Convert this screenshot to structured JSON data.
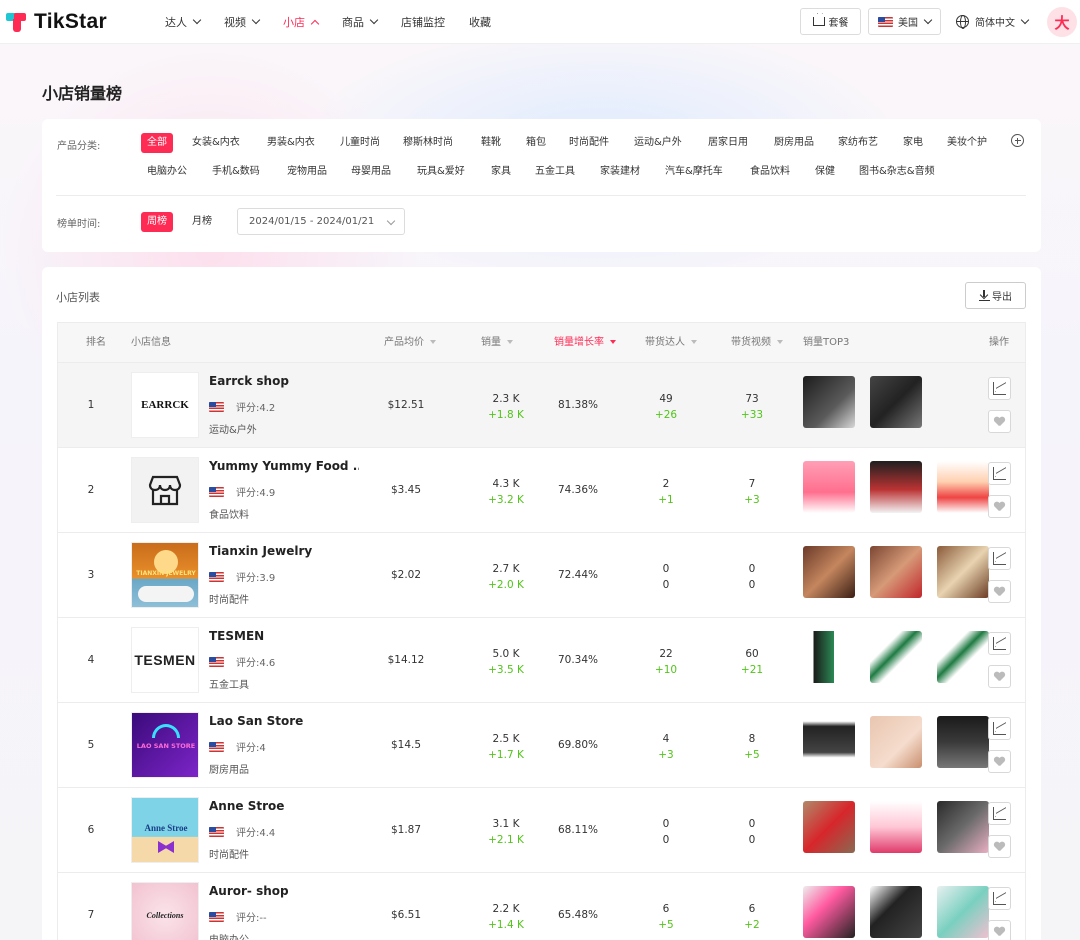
{
  "brand": {
    "name": "TikStar"
  },
  "nav": [
    {
      "label": "达人",
      "dropdown": true,
      "active": false
    },
    {
      "label": "视频",
      "dropdown": true,
      "active": false
    },
    {
      "label": "小店",
      "dropdown": true,
      "active": true
    },
    {
      "label": "商品",
      "dropdown": true,
      "active": false
    },
    {
      "label": "店铺监控",
      "dropdown": false,
      "active": false
    },
    {
      "label": "收藏",
      "dropdown": false,
      "active": false
    }
  ],
  "topbar": {
    "plan_label": "套餐",
    "region_label": "美国",
    "language_label": "简体中文",
    "avatar_text": "大"
  },
  "page": {
    "title": "小店销量榜"
  },
  "filters": {
    "category_label": "产品分类:",
    "categories": [
      "全部",
      "女装&内衣",
      "男装&内衣",
      "儿童时尚",
      "穆斯林时尚",
      "鞋靴",
      "箱包",
      "时尚配件",
      "运动&户外",
      "居家日用",
      "厨房用品",
      "家纺布艺",
      "家电",
      "美妆个护",
      "电脑办公",
      "手机&数码",
      "宠物用品",
      "母婴用品",
      "玩具&爱好",
      "家具",
      "五金工具",
      "家装建材",
      "汽车&摩托车",
      "食品饮料",
      "保健",
      "图书&杂志&音频"
    ],
    "selected_category": "全部",
    "period_label": "榜单时间:",
    "periods": [
      "周榜",
      "月榜"
    ],
    "selected_period": "周榜",
    "date_range": "2024/01/15 - 2024/01/21"
  },
  "list": {
    "title": "小店列表",
    "export_label": "导出",
    "columns": {
      "rank": "排名",
      "shop": "小店信息",
      "price": "产品均价",
      "sales": "销量",
      "growth": "销量增长率",
      "kol": "带货达人",
      "videos": "带货视频",
      "top3": "销量TOP3",
      "actions": "操作"
    },
    "sorted_column": "销量增长率",
    "rows": [
      {
        "rank": "1",
        "name": "Earrck shop",
        "logo_text": "EARRCK",
        "rating": "评分:4.2",
        "category": "运动&户外",
        "price": "$12.51",
        "sales": "2.3 K",
        "sales_delta": "+1.8 K",
        "growth": "81.38%",
        "kol": "49",
        "kol_delta": "+26",
        "videos": "73",
        "videos_delta": "+33",
        "top3_count": 2
      },
      {
        "rank": "2",
        "name": "Yummy Yummy Food ...",
        "logo_text": "",
        "rating": "评分:4.9",
        "category": "食品饮料",
        "price": "$3.45",
        "sales": "4.3 K",
        "sales_delta": "+3.2 K",
        "growth": "74.36%",
        "kol": "2",
        "kol_delta": "+1",
        "videos": "7",
        "videos_delta": "+3",
        "top3_count": 3
      },
      {
        "rank": "3",
        "name": "Tianxin Jewelry",
        "logo_text": "TIANXIN JEWELRY",
        "rating": "评分:3.9",
        "category": "时尚配件",
        "price": "$2.02",
        "sales": "2.7 K",
        "sales_delta": "+2.0 K",
        "growth": "72.44%",
        "kol": "0",
        "kol_delta": "0",
        "videos": "0",
        "videos_delta": "0",
        "top3_count": 3
      },
      {
        "rank": "4",
        "name": "TESMEN",
        "logo_text": "TESMEN",
        "rating": "评分:4.6",
        "category": "五金工具",
        "price": "$14.12",
        "sales": "5.0 K",
        "sales_delta": "+3.5 K",
        "growth": "70.34%",
        "kol": "22",
        "kol_delta": "+10",
        "videos": "60",
        "videos_delta": "+21",
        "top3_count": 3
      },
      {
        "rank": "5",
        "name": "Lao San Store",
        "logo_text": "LAO SAN STORE",
        "rating": "评分:4",
        "category": "厨房用品",
        "price": "$14.5",
        "sales": "2.5 K",
        "sales_delta": "+1.7 K",
        "growth": "69.80%",
        "kol": "4",
        "kol_delta": "+3",
        "videos": "8",
        "videos_delta": "+5",
        "top3_count": 3
      },
      {
        "rank": "6",
        "name": "Anne Stroe",
        "logo_text": "Anne Stroe",
        "rating": "评分:4.4",
        "category": "时尚配件",
        "price": "$1.87",
        "sales": "3.1 K",
        "sales_delta": "+2.1 K",
        "growth": "68.11%",
        "kol": "0",
        "kol_delta": "0",
        "videos": "0",
        "videos_delta": "0",
        "top3_count": 3
      },
      {
        "rank": "7",
        "name": "Auror- shop",
        "logo_text": "Collections",
        "rating": "评分:--",
        "category": "电脑办公",
        "price": "$6.51",
        "sales": "2.2 K",
        "sales_delta": "+1.4 K",
        "growth": "65.48%",
        "kol": "6",
        "kol_delta": "+5",
        "videos": "6",
        "videos_delta": "+2",
        "top3_count": 3
      }
    ]
  },
  "colors": {
    "accent": "#fe2c55",
    "positive": "#52c41a"
  }
}
